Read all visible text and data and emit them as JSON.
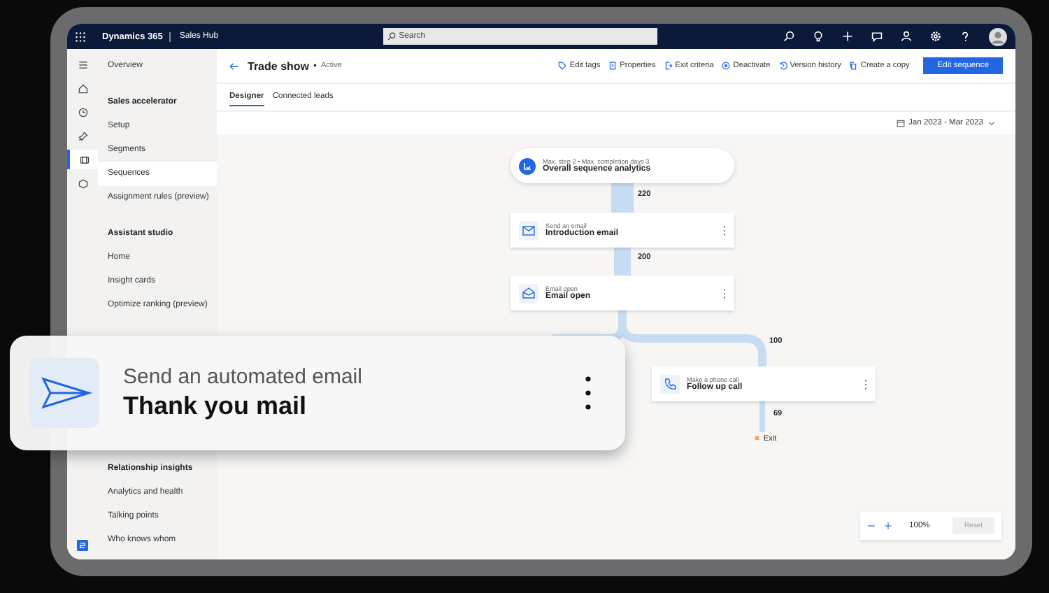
{
  "top_bar": {
    "app_name": "Dynamics 365",
    "area": "Sales Hub",
    "search": {
      "placeholder": "Search"
    }
  },
  "rail": [
    {
      "kind": "menu",
      "selected": false
    },
    {
      "kind": "home",
      "selected": false
    },
    {
      "kind": "recent",
      "selected": false
    },
    {
      "kind": "pinned",
      "selected": false
    },
    {
      "kind": "sequences",
      "selected": true
    },
    {
      "kind": "box",
      "selected": false
    }
  ],
  "sidebar": {
    "groups": [
      {
        "items": [
          {
            "label": "Overview",
            "selected": false
          }
        ]
      },
      {
        "heading": "Sales accelerator",
        "items": [
          {
            "label": "Setup",
            "selected": false
          },
          {
            "label": "Segments",
            "selected": false
          },
          {
            "label": "Sequences",
            "selected": true
          },
          {
            "label": "Assignment rules (preview)",
            "selected": false
          }
        ]
      },
      {
        "heading": "Assistant studio",
        "items": [
          {
            "label": "Home",
            "selected": false
          },
          {
            "label": "Insight cards",
            "selected": false
          },
          {
            "label": "Optimize ranking (preview)",
            "selected": false
          }
        ]
      },
      {
        "heading": "Relationship insights",
        "items": [
          {
            "label": "Analytics and health",
            "selected": false
          },
          {
            "label": "Talking points",
            "selected": false
          },
          {
            "label": "Who knows whom",
            "selected": false
          }
        ]
      }
    ]
  },
  "header": {
    "title": "Trade show",
    "separator": "•",
    "status": "Active",
    "commands": [
      {
        "kind": "tag",
        "label": "Edit tags"
      },
      {
        "kind": "properties",
        "label": "Properties"
      },
      {
        "kind": "exit",
        "label": "Exit criteria"
      },
      {
        "kind": "deactivate",
        "label": "Deactivate"
      },
      {
        "kind": "history",
        "label": "Version history"
      },
      {
        "kind": "copy",
        "label": "Create a copy"
      }
    ],
    "primary_button": "Edit sequence"
  },
  "tabs": [
    {
      "label": "Designer",
      "selected": true
    },
    {
      "label": "Connected leads",
      "selected": false
    }
  ],
  "date_range": "Jan 2023 - Mar 2023",
  "canvas": {
    "summary": {
      "subtitle": "Max. step 2 • Max. completion days 3",
      "title": "Overall sequence analytics"
    },
    "steps": [
      {
        "kind": "email",
        "action": "Send an email",
        "title": "Introduction email"
      },
      {
        "kind": "email-open",
        "action": "Email open",
        "title": "Email open"
      },
      {
        "kind": "phone",
        "action": "Make a phone call",
        "title": "Follow up call"
      }
    ],
    "counts": [
      "220",
      "200",
      "100",
      "69"
    ],
    "exit": "Exit"
  },
  "zoom": {
    "level_text": "100%",
    "reset": {
      "label": "Reset",
      "disabled": true
    }
  },
  "overlay_card": {
    "kind": "automated-email",
    "action": "Send an automated email",
    "title": "Thank you mail"
  }
}
